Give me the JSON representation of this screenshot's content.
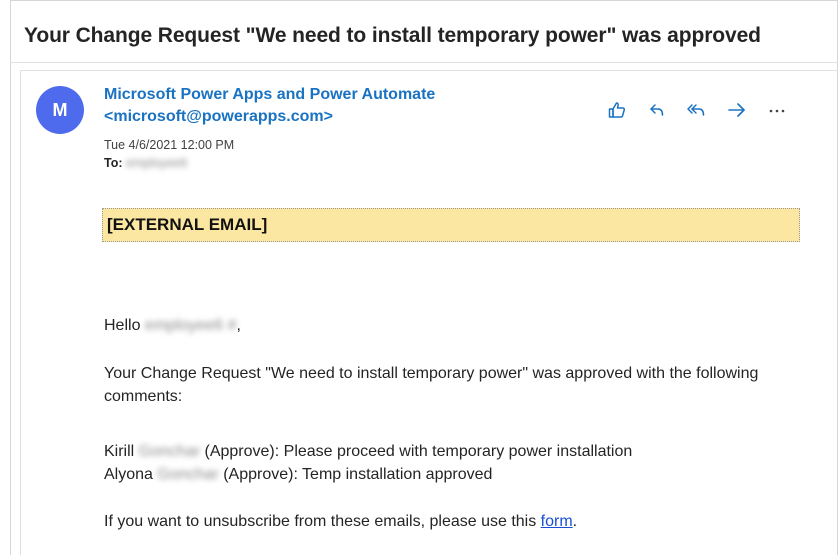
{
  "email": {
    "subject": "Your Change Request \"We need to install temporary power\" was approved",
    "avatar_initial": "M",
    "sender_name": "Microsoft Power Apps and Power Automate",
    "sender_email": "<microsoft@powerapps.com>",
    "date": "Tue 4/6/2021 12:00 PM",
    "to_label": "To:",
    "to_value": "employee6",
    "actions": [
      {
        "name": "like-icon"
      },
      {
        "name": "reply-icon"
      },
      {
        "name": "reply-all-icon"
      },
      {
        "name": "forward-icon"
      },
      {
        "name": "more-icon"
      }
    ],
    "colors": {
      "avatar": "#4f6bed",
      "sender": "#1a73c2",
      "banner": "#fbe7a1",
      "link": "#1a4ed8"
    }
  },
  "body": {
    "external_banner": "[EXTERNAL EMAIL]",
    "greeting_prefix": "Hello",
    "greeting_name": "employee6 #",
    "greeting_suffix": ",",
    "intro": "Your Change Request \"We need to install temporary power\" was approved with the following comments:",
    "comments": [
      {
        "first": "Kirill",
        "last": "Gonchar",
        "text": "(Approve): Please proceed with temporary power installation"
      },
      {
        "first": "Alyona",
        "last": "Gonchar",
        "text": "(Approve): Temp installation approved"
      }
    ],
    "unsubscribe_text": "If you want to unsubscribe from these emails, please use this",
    "unsubscribe_link": "form",
    "unsubscribe_end": "."
  }
}
